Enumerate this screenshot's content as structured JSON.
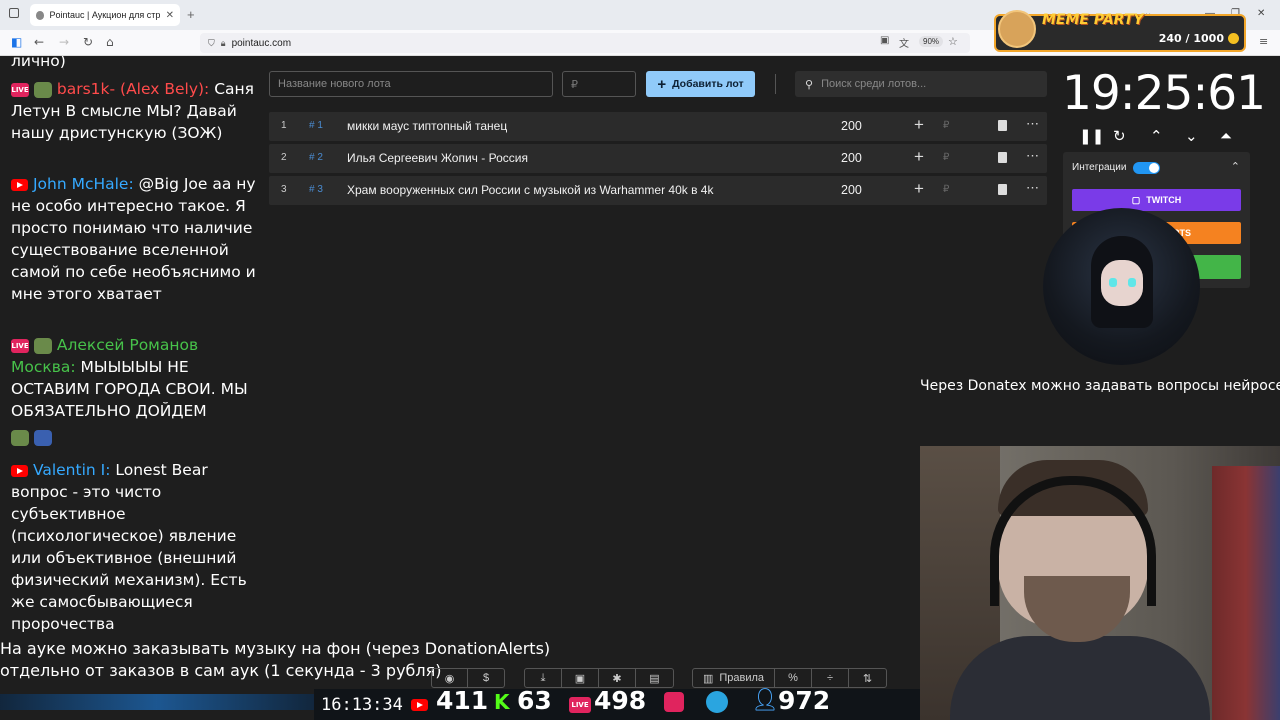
{
  "browser": {
    "tab_title": "Pointauc | Аукцион для стримеров",
    "url": "pointauc.com",
    "zoom": "90%"
  },
  "overlay": {
    "meme_title": "MEME PARTY",
    "meme_count": "240 / 1000"
  },
  "chat": [
    {
      "text": "лично)"
    },
    {
      "user": "bars1k- (Alex Bely):",
      "text": "Саня Летун В смысле МЫ? Давай нашу дристунскую (ЗОЖ)"
    },
    {
      "user": "John McHale:",
      "text": "@Big Joe aa ну не особо интересно такое. Я просто понимаю что наличие существование вселенной самой по себе необъяснимо и мне этого хватает"
    },
    {
      "user": "Алексей Романов Москва:",
      "text": "МЫЫЫЫЫ НЕ ОСТАВИМ ГОРОДА СВОИ. МЫ ОБЯЗАТЕЛЬНО ДОЙДЕМ"
    },
    {
      "user": "Valentin I:",
      "text": "Lonest Bear вопрос - это чисто субъективное (психологическое) явление или объективное (внешний физический механизм). Есть же самосбывающиеся пророчества"
    }
  ],
  "auction": {
    "lot_placeholder": "Название нового лота",
    "price_placeholder": "₽",
    "add_button": "Добавить лот",
    "search_placeholder": "Поиск среди лотов...",
    "lots": [
      {
        "index": "1",
        "hash": "# 1",
        "name": "микки маус типтопный танец",
        "amount": "200"
      },
      {
        "index": "2",
        "hash": "# 2",
        "name": "Илья Сергеевич Жопич - Россия",
        "amount": "200"
      },
      {
        "index": "3",
        "hash": "# 3",
        "name": "Храм вооруженных сил России с музыкой из Warhammer 40k в 4k",
        "amount": "200"
      }
    ]
  },
  "timer": {
    "value": "19:25:61"
  },
  "integrations": {
    "label": "Интеграции",
    "twitch": "TWITCH",
    "donationalerts": "ALERTS"
  },
  "donatex_text": "Через Donatex можно задавать вопросы нейросети",
  "notice": {
    "line1": "На ауке можно заказывать музыку на фон (через DonationAlerts)",
    "line2": "отдельно от заказов в сам аук (1 секунда - 3 рубля)"
  },
  "toolbar": {
    "rules": "Правила"
  },
  "stats": {
    "clock": "16:13:34",
    "youtube": "411",
    "kick": "63",
    "live": "498",
    "telegram_or_total": "972"
  },
  "colors": {
    "accent_button": "#90caf9",
    "twitch": "#7a3be8",
    "donationalerts": "#f58220",
    "green_integration": "#43b548"
  }
}
